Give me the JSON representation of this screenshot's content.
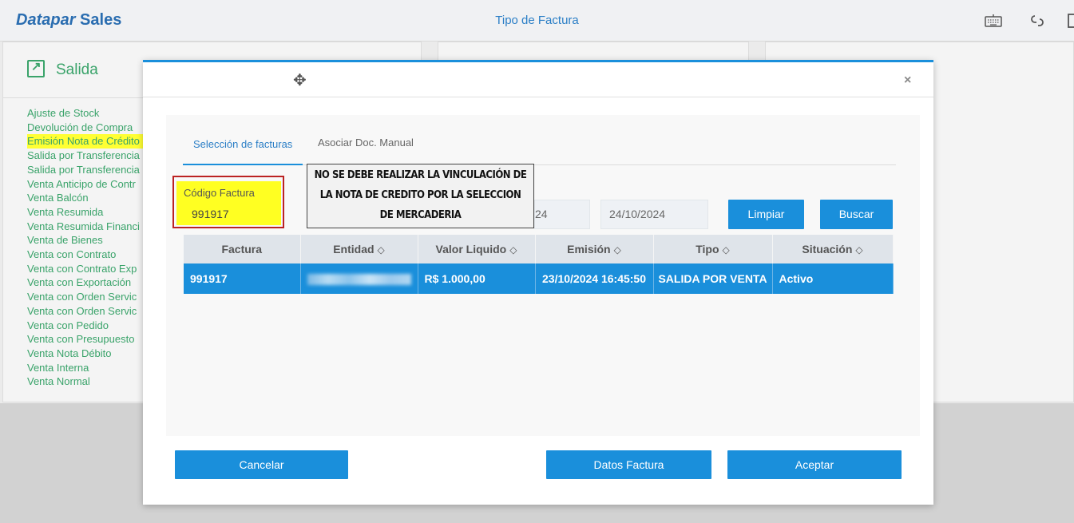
{
  "header": {
    "brand_part1": "Datapar",
    "brand_part2": "Sales",
    "title": "Tipo de Factura",
    "icons": [
      "keyboard-icon",
      "link-icon",
      "screen-icon"
    ]
  },
  "left_card": {
    "title": "Salida",
    "items": [
      "Ajuste de Stock",
      "Devolución de Compra",
      "Emisión Nota de Crédito",
      "Salida por Transferencia",
      "Salida por Transferencia",
      "Venta Anticipo de Contr",
      "Venta Balcón",
      "Venta Resumida",
      "Venta Resumida Financi",
      "Venta de Bienes",
      "Venta con Contrato",
      "Venta con Contrato Exp",
      "Venta con Exportación",
      "Venta con Orden Servic",
      "Venta con Orden Servic",
      "Venta con Pedido",
      "Venta con Presupuesto",
      "Venta Nota Débito",
      "Venta Interna",
      "Venta Normal"
    ],
    "highlighted_index": 2
  },
  "modal": {
    "tabs": [
      "Selección de facturas",
      "Asociar Doc. Manual"
    ],
    "active_tab": 0,
    "code_label": "Código Factura",
    "code_value": "991917",
    "annotation_line1": "NO SE DEBE REALIZAR LA VINCULACIÓN DE",
    "annotation_line2": "LA NOTA DE CREDITO POR LA SELECCION",
    "annotation_line3": "DE MERCADERIA",
    "date_from_partial": "24",
    "date_to": "24/10/2024",
    "btn_limpiar": "Limpiar",
    "btn_buscar": "Buscar",
    "columns": [
      "Factura",
      "Entidad",
      "Valor Liquido",
      "Emisión",
      "Tipo",
      "Situación"
    ],
    "sort_glyph": "◇",
    "row": {
      "factura": "991917",
      "valor": "R$ 1.000,00",
      "emision": "23/10/2024 16:45:50",
      "tipo": "SALIDA POR VENTA",
      "situacion": "Activo"
    },
    "btn_cancelar": "Cancelar",
    "btn_datos": "Datos Factura",
    "btn_aceptar": "Aceptar",
    "close_glyph": "×",
    "move_glyph": "✥"
  },
  "colors": {
    "accent": "#1a8fdb",
    "green": "#3aa36a",
    "highlight": "#ffff33"
  }
}
